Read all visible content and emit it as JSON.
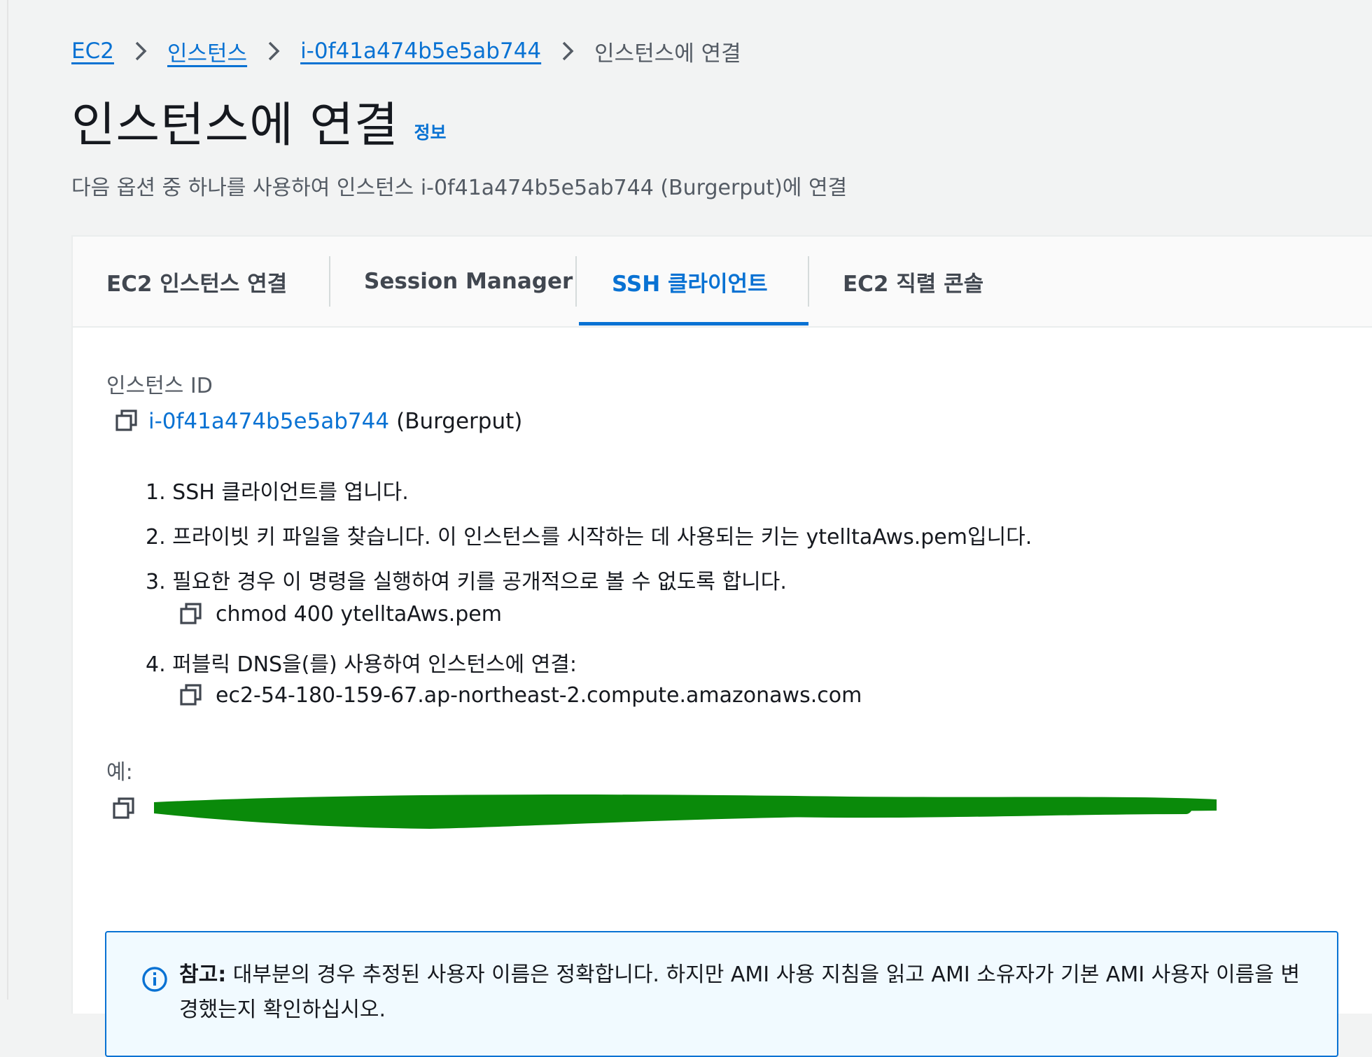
{
  "breadcrumb": {
    "items": [
      "EC2",
      "인스턴스",
      "i-0f41a474b5e5ab744"
    ],
    "current": "인스턴스에 연결"
  },
  "header": {
    "title": "인스턴스에 연결",
    "info": "정보",
    "description": "다음 옵션 중 하나를 사용하여 인스턴스 i-0f41a474b5e5ab744 (Burgerput)에 연결"
  },
  "tabs": [
    {
      "label": "EC2 인스턴스 연결",
      "active": false
    },
    {
      "label": "Session Manager",
      "active": false
    },
    {
      "label": "SSH 클라이언트",
      "active": true
    },
    {
      "label": "EC2 직렬 콘솔",
      "active": false
    }
  ],
  "instance": {
    "label": "인스턴스 ID",
    "id": "i-0f41a474b5e5ab744",
    "name": "(Burgerput)"
  },
  "steps": [
    "1. SSH 클라이언트를 엽니다.",
    "2. 프라이빗 키 파일을 찾습니다. 이 인스턴스를 시작하는 데 사용되는 키는 ytelltaAws.pem입니다.",
    "3. 필요한 경우 이 명령을 실행하여 키를 공개적으로 볼 수 없도록 합니다.",
    "4. 퍼블릭 DNS을(를) 사용하여 인스턴스에 연결:"
  ],
  "commands": {
    "chmod": "chmod 400 ytelltaAws.pem",
    "dns": "ec2-54-180-159-67.ap-northeast-2.compute.amazonaws.com"
  },
  "example": {
    "label": "예:"
  },
  "alert": {
    "strong": "참고:",
    "text": " 대부분의 경우 추정된 사용자 이름은 정확합니다. 하지만 AMI 사용 지침을 읽고 AMI 소유자가 기본 AMI 사용자 이름을 변경했는지 확인하십시오."
  },
  "colors": {
    "link": "#0972d3",
    "background": "#f2f3f3",
    "redaction": "#0a8a0a"
  }
}
